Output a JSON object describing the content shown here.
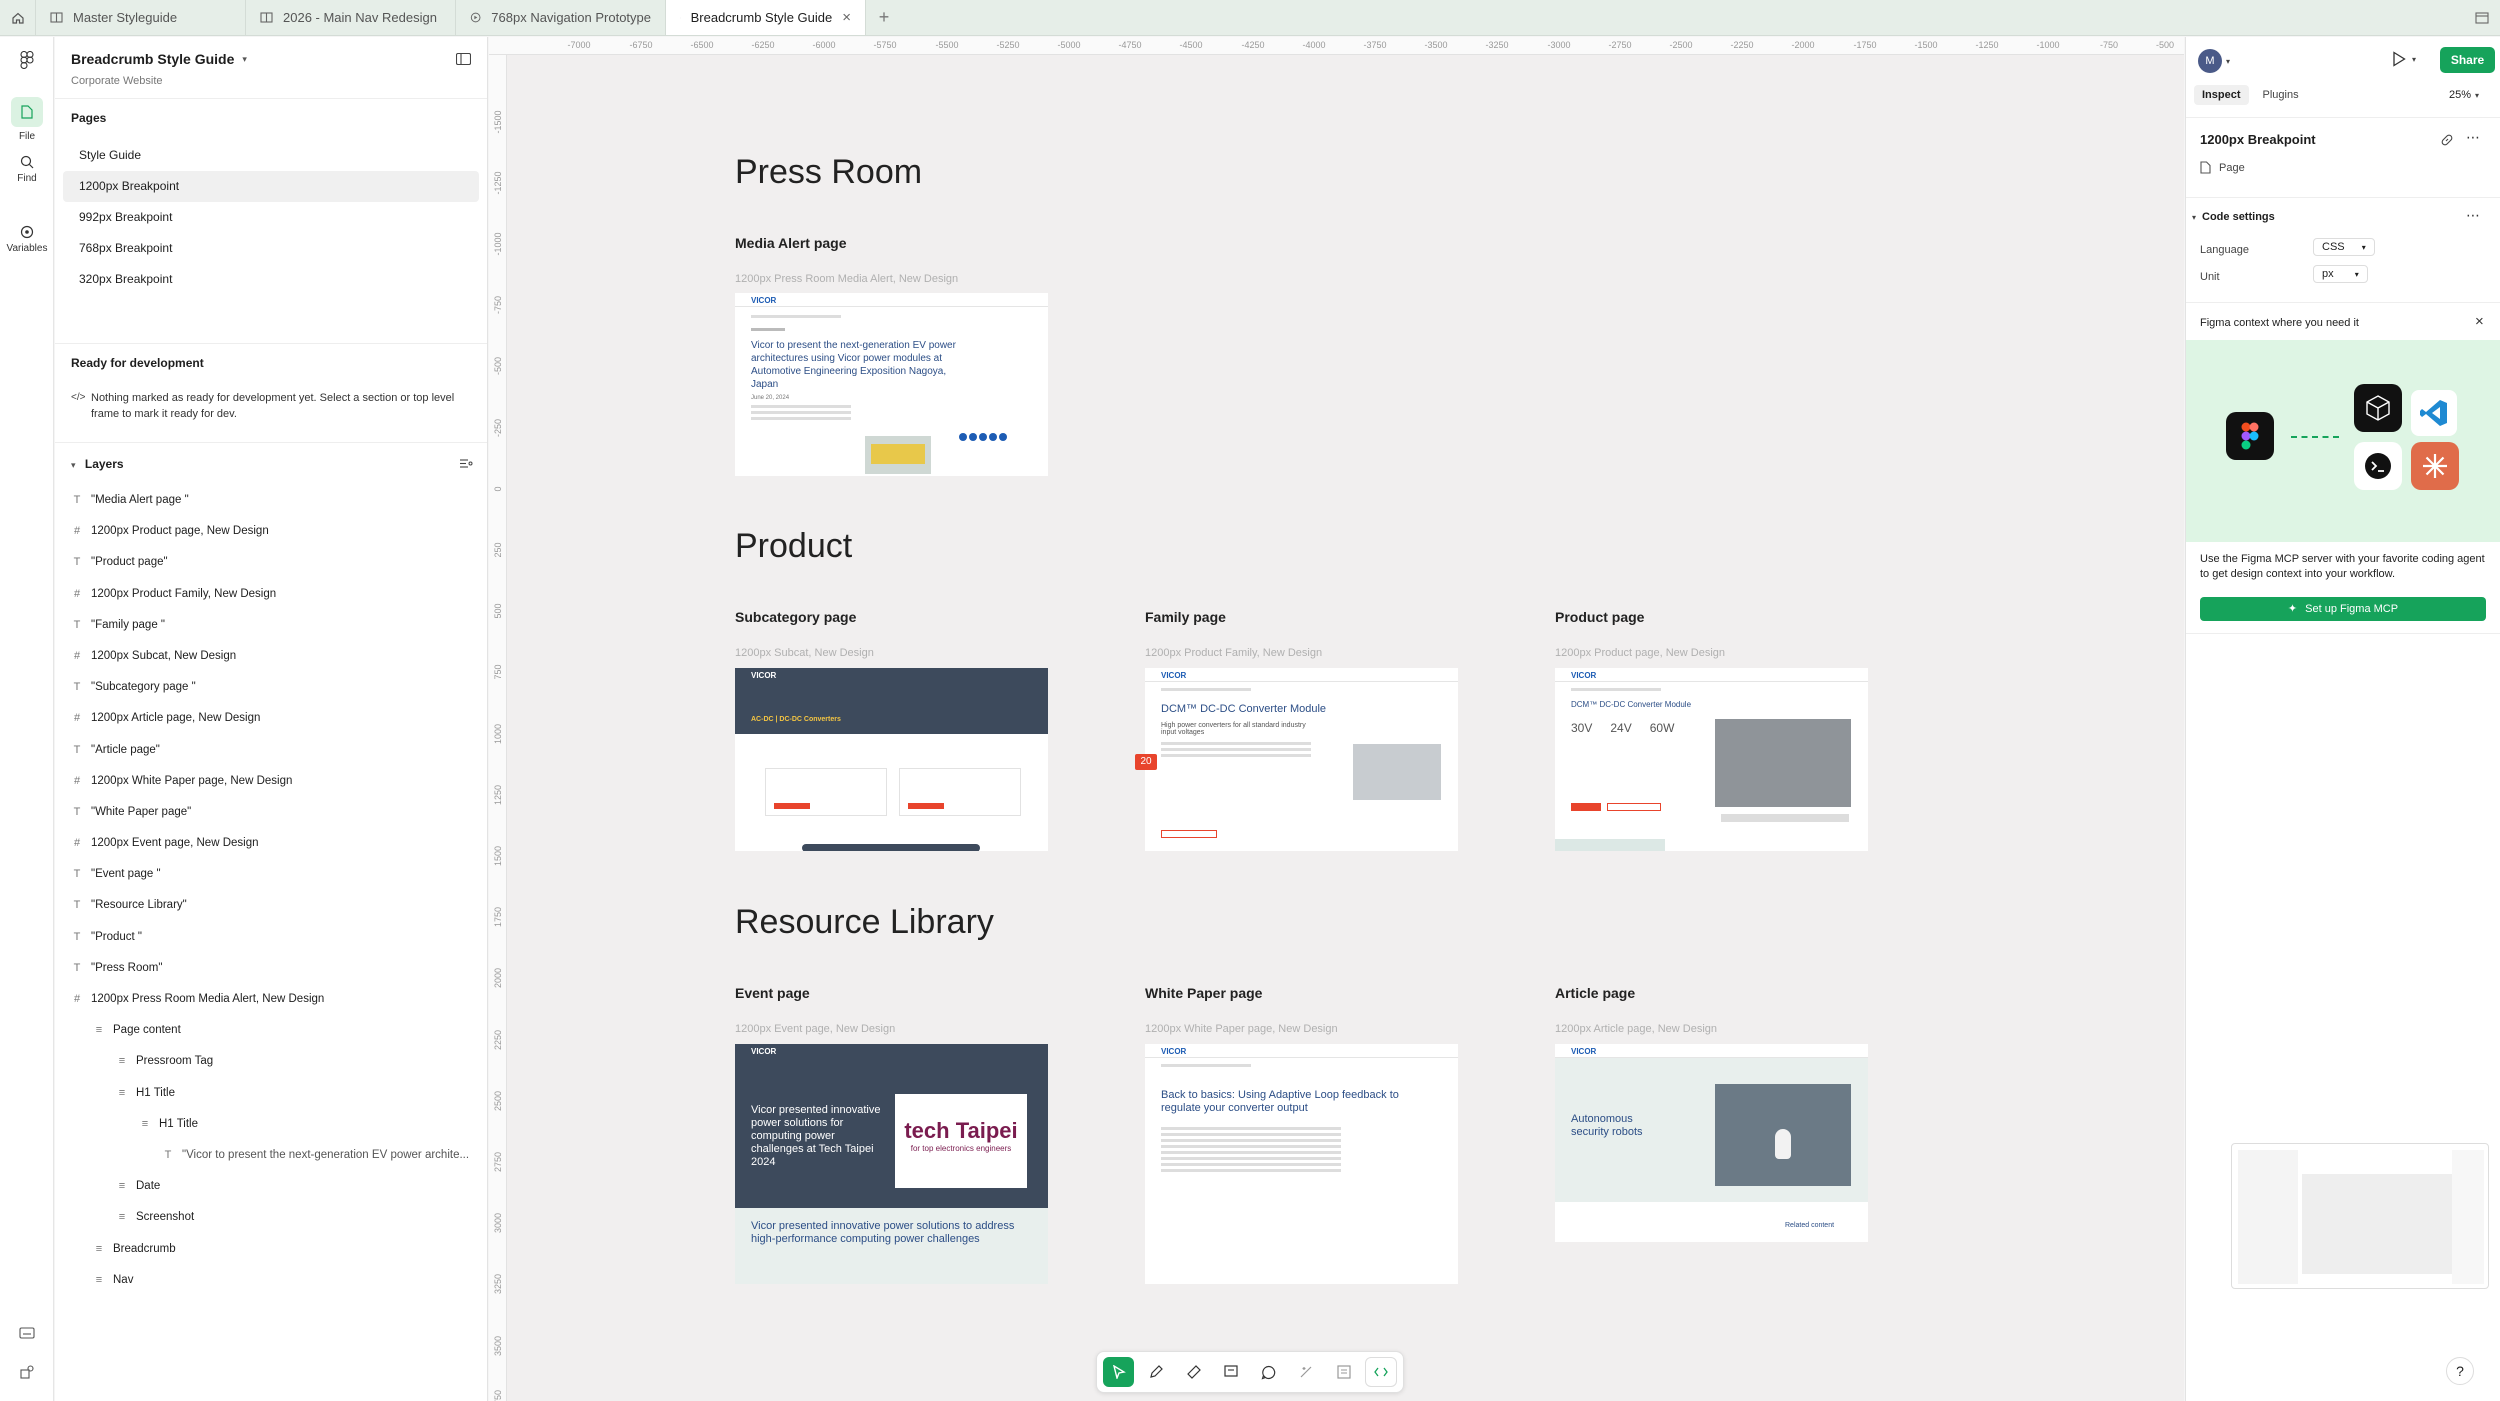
{
  "tabs": [
    {
      "label": "Master Styleguide"
    },
    {
      "label": "2026 - Main Nav Redesign"
    },
    {
      "label": "768px Navigation Prototype"
    },
    {
      "label": "Breadcrumb Style Guide"
    }
  ],
  "rail": {
    "file": "File",
    "find": "Find",
    "variables": "Variables"
  },
  "file": {
    "title": "Breadcrumb Style Guide",
    "subtitle": "Corporate Website"
  },
  "pages": {
    "heading": "Pages",
    "items": [
      "Style Guide",
      "1200px Breakpoint",
      "992px Breakpoint",
      "768px Breakpoint",
      "320px Breakpoint"
    ]
  },
  "ready": {
    "heading": "Ready for development",
    "text": "Nothing marked as ready for development yet. Select a section or top level frame to mark it ready for dev."
  },
  "layers": {
    "heading": "Layers",
    "items": [
      "\"Media Alert page \"",
      "1200px Product page, New Design",
      "\"Product page\"",
      "1200px Product Family, New Design",
      "\"Family page \"",
      "1200px Subcat, New Design",
      "\"Subcategory page \"",
      "1200px Article page, New Design",
      "\"Article page\"",
      "1200px White Paper page, New Design",
      "\"White Paper page\"",
      "1200px Event page, New Design",
      "\"Event page \"",
      "\"Resource Library\"",
      "\"Product \"",
      "\"Press Room\"",
      "1200px Press Room Media Alert, New Design",
      "Page content",
      "Pressroom Tag",
      "H1 Title",
      "H1 Title",
      "\"Vicor to present the next-generation EV power archite...",
      "Date",
      "Screenshot",
      "Breadcrumb",
      "Nav"
    ]
  },
  "ruler": {
    "top": [
      "-7000",
      "-6750",
      "-6500",
      "-6250",
      "-6000",
      "-5750",
      "-5500",
      "-5250",
      "-5000",
      "-4750",
      "-4500",
      "-4250",
      "-4000",
      "-3750",
      "-3500",
      "-3250",
      "-3000",
      "-2750",
      "-2500",
      "-2250",
      "-2000",
      "-1750",
      "-1500",
      "-1250",
      "-1000",
      "-750",
      "-500"
    ],
    "left": [
      "-1500",
      "-1250",
      "-1000",
      "-750",
      "-500",
      "-250",
      "0",
      "250",
      "500",
      "750",
      "1000",
      "1250",
      "1500",
      "1750",
      "2000",
      "2250",
      "2500",
      "2750",
      "3000",
      "3250",
      "3500",
      "3750"
    ]
  },
  "canvas": {
    "sections": [
      "Press Room",
      "Product",
      "Resource Library"
    ],
    "cards": [
      {
        "title": "Media Alert page",
        "frame": "1200px Press Room Media Alert, New Design",
        "headline": "Vicor to present the next-generation EV power architectures using Vicor power modules at Automotive Engineering Exposition Nagoya, Japan",
        "date": "June 20, 2024"
      },
      {
        "title": "Subcategory page",
        "frame": "1200px Subcat, New Design",
        "headline": "AC-DC | DC-DC Converters"
      },
      {
        "title": "Family page",
        "frame": "1200px Product Family, New Design",
        "headline": "DCM™ DC-DC Converter Module",
        "sub": "High power converters for all standard industry input voltages"
      },
      {
        "title": "Product page",
        "frame": "1200px Product page, New Design",
        "headline": "DCM™ DC-DC Converter Module",
        "values": [
          "30V",
          "24V",
          "60W"
        ]
      },
      {
        "title": "Event page",
        "frame": "1200px Event page, New Design",
        "headline": "Vicor presented innovative power solutions for computing power challenges at Tech Taipei 2024",
        "banner": "tech Taipei",
        "banner_sub": "for top electronics engineers",
        "footer": "Vicor presented innovative power solutions to address high-performance computing power challenges"
      },
      {
        "title": "White Paper page",
        "frame": "1200px White Paper page, New Design",
        "headline": "Back to basics: Using Adaptive Loop feedback to regulate your converter output"
      },
      {
        "title": "Article page",
        "frame": "1200px Article page, New Design",
        "headline": "Autonomous security robots",
        "related": "Related content"
      }
    ],
    "badge": "20",
    "logo": "VICOR"
  },
  "right": {
    "avatar": "M",
    "share": "Share",
    "tabs": [
      "Inspect",
      "Plugins"
    ],
    "zoom": "25%",
    "selection": "1200px Breakpoint",
    "selection_type": "Page",
    "code_settings": "Code settings",
    "language_label": "Language",
    "language": "CSS",
    "unit_label": "Unit",
    "unit": "px",
    "promo_title": "Figma context where you need it",
    "promo_text": "Use the Figma MCP server with your favorite coding agent to get design context into your workflow.",
    "setup": "Set up Figma MCP"
  },
  "help": "?",
  "colors": {
    "accent": "#16a35b",
    "tabbar": "#e6eee8",
    "canvas": "#f1efef",
    "vicor_blue": "#1d5cb4",
    "vicor_dark": "#3d4a5c"
  }
}
